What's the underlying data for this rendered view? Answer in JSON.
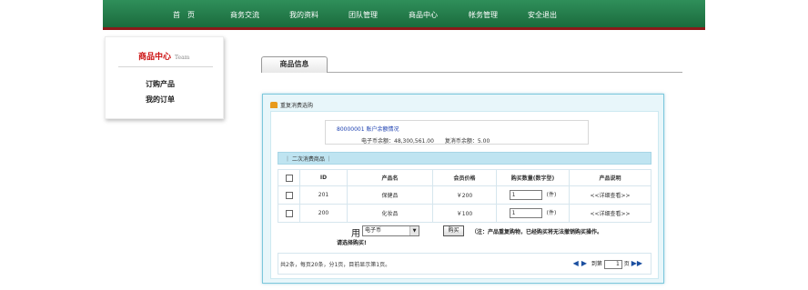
{
  "nav": {
    "items": [
      "首　页",
      "商务交流",
      "我的资料",
      "团队管理",
      "商品中心",
      "帐务管理",
      "安全退出"
    ]
  },
  "sidebar": {
    "title": "商品中心",
    "title_en": "Team",
    "links": [
      "订购产品",
      "我的订单"
    ]
  },
  "tab": {
    "label": "商品信息"
  },
  "panel": {
    "heading": "重复消费选购",
    "account_id": "80000001",
    "account_label": "账户余额情况",
    "balance": "电子币余额：48,300,561.00　　复消币余额：5.00",
    "category": "｜ 二次消费商品 ｜"
  },
  "table": {
    "headers": [
      "",
      "ID",
      "产品名",
      "会员价格",
      "购买数量(数字型)",
      "产品说明"
    ],
    "rows": [
      {
        "id": "201",
        "name": "保健品",
        "price": "￥200",
        "qty": "1",
        "unit": "(件)",
        "detail": "<<详细查看>>"
      },
      {
        "id": "200",
        "name": "化妆品",
        "price": "￥100",
        "qty": "1",
        "unit": "(件)",
        "detail": "<<详细查看>>"
      }
    ]
  },
  "purchase": {
    "use_label": "用",
    "select_value": "电子币",
    "pick_label": "请选择购买!",
    "buy_button": "购买",
    "note": "（注：产品重复购物，已经购买将无法撤销购买操作。"
  },
  "footer": {
    "page_info": "共2条，每页20条，分1页，目前显示第1页。",
    "goto_label": "到第",
    "page_value": "1",
    "page_suffix": "页"
  }
}
